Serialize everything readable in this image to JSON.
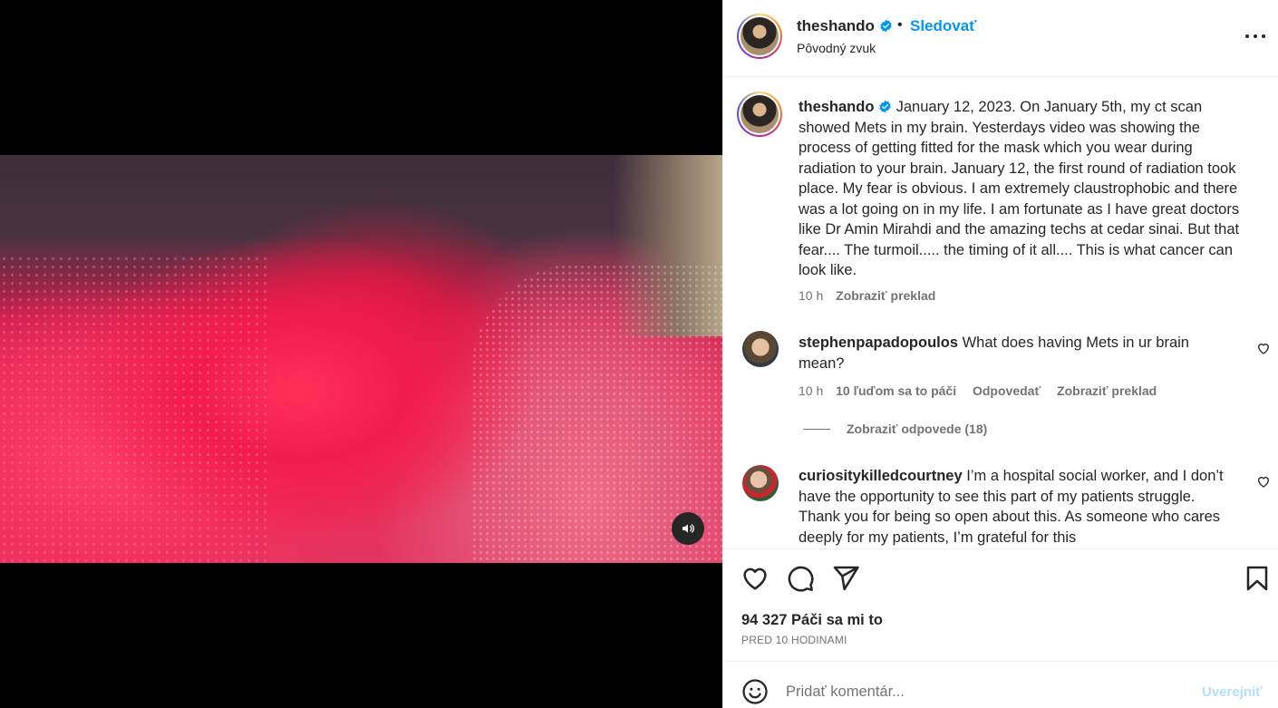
{
  "post": {
    "username": "theshando",
    "follow_label": "Sledovať",
    "separator": "•",
    "audio_label": "Pôvodný zvuk"
  },
  "caption": {
    "username": "theshando",
    "text": "January 12, 2023. On January 5th, my ct scan showed Mets in my brain. Yesterdays video was showing the process of getting fitted for the mask which you wear during radiation to your brain. January 12, the first round of radiation took place. My fear is obvious. I am extremely claustrophobic and there was a lot going on in my life. I am fortunate as I have great doctors like Dr Amin Mirahdi and the amazing techs at cedar sinai. But that fear.... The turmoil..... the timing of it all.... This is what cancer can look like.",
    "time": "10 h",
    "translate": "Zobraziť preklad"
  },
  "comments": [
    {
      "username": "stephenpapadopoulos",
      "text": "What does having Mets in ur brain mean?",
      "time": "10 h",
      "likes": "10 ľuďom sa to páči",
      "reply": "Odpovedať",
      "translate": "Zobraziť preklad",
      "view_replies": "Zobraziť odpovede (18)"
    },
    {
      "username": "curiositykilledcourtney",
      "text": "I’m a hospital social worker, and I don’t have the opportunity to see this part of my patients struggle. Thank you for being so open about this. As someone who cares deeply for my patients, I’m grateful for this"
    }
  ],
  "actions": {
    "likes_count": "94 327 Páči sa mi to",
    "time_ago": "PRED 10 HODINAMI"
  },
  "add_comment": {
    "placeholder": "Pridať komentár...",
    "post_label": "Uverejniť"
  },
  "colors": {
    "accent": "#0095f6",
    "secondary_text": "#737373",
    "post_disabled": "#b2dffc"
  },
  "icons": [
    "sound-icon",
    "verified-icon",
    "more-icon",
    "heart-icon",
    "comment-icon",
    "share-icon",
    "save-icon",
    "emoji-icon"
  ]
}
